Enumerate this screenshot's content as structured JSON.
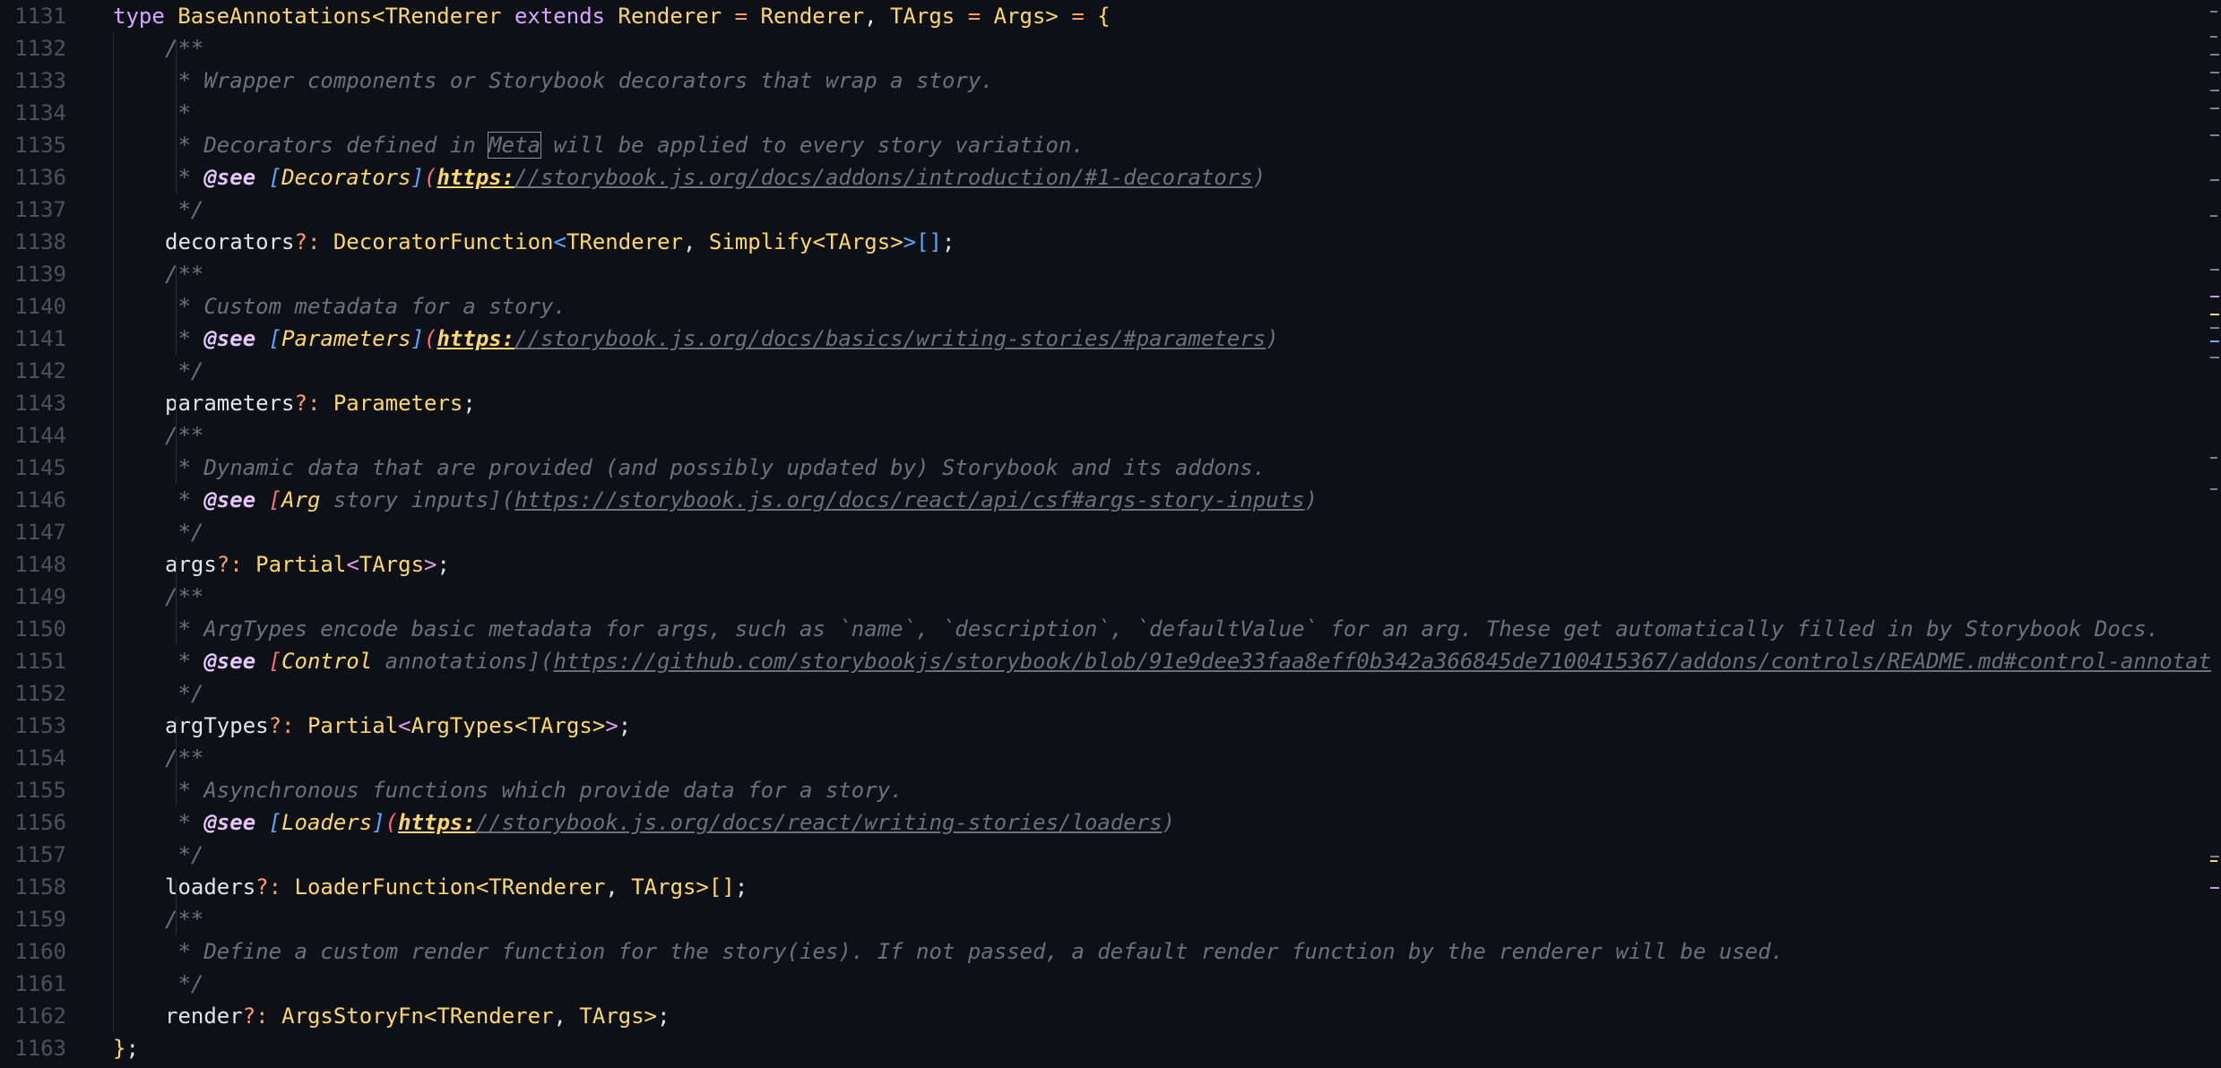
{
  "editor": {
    "lines": [
      {
        "n": "1131",
        "indent": 0,
        "tokens": [
          {
            "t": "type ",
            "c": "kw2"
          },
          {
            "t": "BaseAnnotations",
            "c": "ty"
          },
          {
            "t": "<",
            "c": "br1"
          },
          {
            "t": "TRenderer ",
            "c": "ty"
          },
          {
            "t": "extends ",
            "c": "kw2"
          },
          {
            "t": "Renderer ",
            "c": "ty"
          },
          {
            "t": "= ",
            "c": "op"
          },
          {
            "t": "Renderer",
            "c": "ty"
          },
          {
            "t": ", ",
            "c": "pn"
          },
          {
            "t": "TArgs ",
            "c": "ty"
          },
          {
            "t": "= ",
            "c": "op"
          },
          {
            "t": "Args",
            "c": "ty"
          },
          {
            "t": "> ",
            "c": "br1"
          },
          {
            "t": "= ",
            "c": "op"
          },
          {
            "t": "{",
            "c": "br1"
          }
        ]
      },
      {
        "n": "1132",
        "indent": 1,
        "tokens": [
          {
            "t": "/**",
            "c": "cm"
          }
        ]
      },
      {
        "n": "1133",
        "indent": 1,
        "tokens": [
          {
            "t": " * Wrapper components or Storybook decorators that wrap a story.",
            "c": "cm"
          }
        ]
      },
      {
        "n": "1134",
        "indent": 1,
        "tokens": [
          {
            "t": " *",
            "c": "cm"
          }
        ]
      },
      {
        "n": "1135",
        "indent": 1,
        "tokens": [
          {
            "t": " * Decorators defined in ",
            "c": "cm"
          },
          {
            "t": "Meta",
            "c": "cm boxed"
          },
          {
            "t": " will be applied to every story variation.",
            "c": "cm"
          }
        ]
      },
      {
        "n": "1136",
        "indent": 1,
        "tokens": [
          {
            "t": " * ",
            "c": "cm"
          },
          {
            "t": "@see ",
            "c": "tag"
          },
          {
            "t": "[",
            "c": "lkb1"
          },
          {
            "t": "Decorators",
            "c": "lk"
          },
          {
            "t": "]",
            "c": "lkb1"
          },
          {
            "t": "(",
            "c": "lkb2"
          },
          {
            "t": "https:",
            "c": "urlh"
          },
          {
            "t": "//storybook.js.org/docs/addons/introduction/#1-decorators",
            "c": "url"
          },
          {
            "t": ")",
            "c": "cm"
          }
        ]
      },
      {
        "n": "1137",
        "indent": 1,
        "tokens": [
          {
            "t": " */",
            "c": "cm"
          }
        ]
      },
      {
        "n": "1138",
        "indent": 1,
        "tokens": [
          {
            "t": "decorators",
            "c": "pl"
          },
          {
            "t": "?: ",
            "c": "op"
          },
          {
            "t": "DecoratorFunction",
            "c": "ty"
          },
          {
            "t": "<",
            "c": "br3"
          },
          {
            "t": "TRenderer",
            "c": "ty"
          },
          {
            "t": ", ",
            "c": "pn"
          },
          {
            "t": "Simplify",
            "c": "ty"
          },
          {
            "t": "<",
            "c": "br1"
          },
          {
            "t": "TArgs",
            "c": "ty"
          },
          {
            "t": ">",
            "c": "br1"
          },
          {
            "t": ">",
            "c": "br3"
          },
          {
            "t": "[]",
            "c": "br3"
          },
          {
            "t": ";",
            "c": "pn"
          }
        ]
      },
      {
        "n": "1139",
        "indent": 1,
        "tokens": [
          {
            "t": "/**",
            "c": "cm"
          }
        ]
      },
      {
        "n": "1140",
        "indent": 1,
        "tokens": [
          {
            "t": " * Custom metadata for a story.",
            "c": "cm"
          }
        ]
      },
      {
        "n": "1141",
        "indent": 1,
        "tokens": [
          {
            "t": " * ",
            "c": "cm"
          },
          {
            "t": "@see ",
            "c": "tag"
          },
          {
            "t": "[",
            "c": "lkb1"
          },
          {
            "t": "Parameters",
            "c": "lk"
          },
          {
            "t": "]",
            "c": "lkb1"
          },
          {
            "t": "(",
            "c": "lkb2"
          },
          {
            "t": "https:",
            "c": "urlh"
          },
          {
            "t": "//storybook.js.org/docs/basics/writing-stories/#parameters",
            "c": "url"
          },
          {
            "t": ")",
            "c": "cm"
          }
        ]
      },
      {
        "n": "1142",
        "indent": 1,
        "tokens": [
          {
            "t": " */",
            "c": "cm"
          }
        ]
      },
      {
        "n": "1143",
        "indent": 1,
        "tokens": [
          {
            "t": "parameters",
            "c": "pl"
          },
          {
            "t": "?: ",
            "c": "op"
          },
          {
            "t": "Parameters",
            "c": "ty"
          },
          {
            "t": ";",
            "c": "pn"
          }
        ]
      },
      {
        "n": "1144",
        "indent": 1,
        "tokens": [
          {
            "t": "/**",
            "c": "cm"
          }
        ]
      },
      {
        "n": "1145",
        "indent": 1,
        "tokens": [
          {
            "t": " * Dynamic data that are provided (and possibly updated by) Storybook and its addons.",
            "c": "cm"
          }
        ]
      },
      {
        "n": "1146",
        "indent": 1,
        "tokens": [
          {
            "t": " * ",
            "c": "cm"
          },
          {
            "t": "@see ",
            "c": "tag"
          },
          {
            "t": "[",
            "c": "lkb2"
          },
          {
            "t": "Arg",
            "c": "lk"
          },
          {
            "t": " story inputs](",
            "c": "cm"
          },
          {
            "t": "https://storybook.js.org/docs/react/api/csf#args-story-inputs",
            "c": "url"
          },
          {
            "t": ")",
            "c": "cm"
          }
        ]
      },
      {
        "n": "1147",
        "indent": 1,
        "tokens": [
          {
            "t": " */",
            "c": "cm"
          }
        ]
      },
      {
        "n": "1148",
        "indent": 1,
        "tokens": [
          {
            "t": "args",
            "c": "pl"
          },
          {
            "t": "?: ",
            "c": "op"
          },
          {
            "t": "Partial",
            "c": "ty"
          },
          {
            "t": "<",
            "c": "br2"
          },
          {
            "t": "TArgs",
            "c": "ty"
          },
          {
            "t": ">",
            "c": "br2"
          },
          {
            "t": ";",
            "c": "pn"
          }
        ]
      },
      {
        "n": "1149",
        "indent": 1,
        "tokens": [
          {
            "t": "/**",
            "c": "cm"
          }
        ]
      },
      {
        "n": "1150",
        "indent": 1,
        "tokens": [
          {
            "t": " * ArgTypes encode basic metadata for args, such as `name`, `description`, `defaultValue` for an arg. These get automatically filled in by Storybook Docs.",
            "c": "cm"
          }
        ]
      },
      {
        "n": "1151",
        "indent": 1,
        "tokens": [
          {
            "t": " * ",
            "c": "cm"
          },
          {
            "t": "@see ",
            "c": "tag"
          },
          {
            "t": "[",
            "c": "lkb2"
          },
          {
            "t": "Control",
            "c": "lk"
          },
          {
            "t": " annotations](",
            "c": "cm"
          },
          {
            "t": "https://github.com/storybookjs/storybook/blob/91e9dee33faa8eff0b342a366845de7100415367/addons/controls/README.md#control-annotat",
            "c": "url"
          }
        ]
      },
      {
        "n": "1152",
        "indent": 1,
        "tokens": [
          {
            "t": " */",
            "c": "cm"
          }
        ]
      },
      {
        "n": "1153",
        "indent": 1,
        "tokens": [
          {
            "t": "argTypes",
            "c": "pl"
          },
          {
            "t": "?: ",
            "c": "op"
          },
          {
            "t": "Partial",
            "c": "ty"
          },
          {
            "t": "<",
            "c": "br2"
          },
          {
            "t": "ArgTypes",
            "c": "ty"
          },
          {
            "t": "<",
            "c": "br1"
          },
          {
            "t": "TArgs",
            "c": "ty"
          },
          {
            "t": ">",
            "c": "br1"
          },
          {
            "t": ">",
            "c": "br2"
          },
          {
            "t": ";",
            "c": "pn"
          }
        ]
      },
      {
        "n": "1154",
        "indent": 1,
        "tokens": [
          {
            "t": "/**",
            "c": "cm"
          }
        ]
      },
      {
        "n": "1155",
        "indent": 1,
        "tokens": [
          {
            "t": " * Asynchronous functions which provide data for a story.",
            "c": "cm"
          }
        ]
      },
      {
        "n": "1156",
        "indent": 1,
        "tokens": [
          {
            "t": " * ",
            "c": "cm"
          },
          {
            "t": "@see ",
            "c": "tag"
          },
          {
            "t": "[",
            "c": "lkb1"
          },
          {
            "t": "Loaders",
            "c": "lk"
          },
          {
            "t": "]",
            "c": "lkb1"
          },
          {
            "t": "(",
            "c": "lkb2"
          },
          {
            "t": "https:",
            "c": "urlh"
          },
          {
            "t": "//storybook.js.org/docs/react/writing-stories/loaders",
            "c": "url"
          },
          {
            "t": ")",
            "c": "cm"
          }
        ]
      },
      {
        "n": "1157",
        "indent": 1,
        "tokens": [
          {
            "t": " */",
            "c": "cm"
          }
        ]
      },
      {
        "n": "1158",
        "indent": 1,
        "tokens": [
          {
            "t": "loaders",
            "c": "pl"
          },
          {
            "t": "?: ",
            "c": "op"
          },
          {
            "t": "LoaderFunction",
            "c": "ty"
          },
          {
            "t": "<",
            "c": "br1"
          },
          {
            "t": "TRenderer",
            "c": "ty"
          },
          {
            "t": ", ",
            "c": "pn"
          },
          {
            "t": "TArgs",
            "c": "ty"
          },
          {
            "t": ">",
            "c": "br1"
          },
          {
            "t": "[]",
            "c": "br1"
          },
          {
            "t": ";",
            "c": "pn"
          }
        ]
      },
      {
        "n": "1159",
        "indent": 1,
        "tokens": [
          {
            "t": "/**",
            "c": "cm"
          }
        ]
      },
      {
        "n": "1160",
        "indent": 1,
        "tokens": [
          {
            "t": " * Define a custom render function for the story(ies). If not passed, a default render function by the renderer will be used.",
            "c": "cm"
          }
        ]
      },
      {
        "n": "1161",
        "indent": 1,
        "tokens": [
          {
            "t": " */",
            "c": "cm"
          }
        ]
      },
      {
        "n": "1162",
        "indent": 1,
        "tokens": [
          {
            "t": "render",
            "c": "pl"
          },
          {
            "t": "?: ",
            "c": "op"
          },
          {
            "t": "ArgsStoryFn",
            "c": "ty"
          },
          {
            "t": "<",
            "c": "br1"
          },
          {
            "t": "TRenderer",
            "c": "ty"
          },
          {
            "t": ", ",
            "c": "pn"
          },
          {
            "t": "TArgs",
            "c": "ty"
          },
          {
            "t": ">",
            "c": "br1"
          },
          {
            "t": ";",
            "c": "pn"
          }
        ]
      },
      {
        "n": "1163",
        "indent": 0,
        "tokens": [
          {
            "t": "}",
            "c": "br1"
          },
          {
            "t": ";",
            "c": "pn"
          }
        ]
      }
    ]
  }
}
